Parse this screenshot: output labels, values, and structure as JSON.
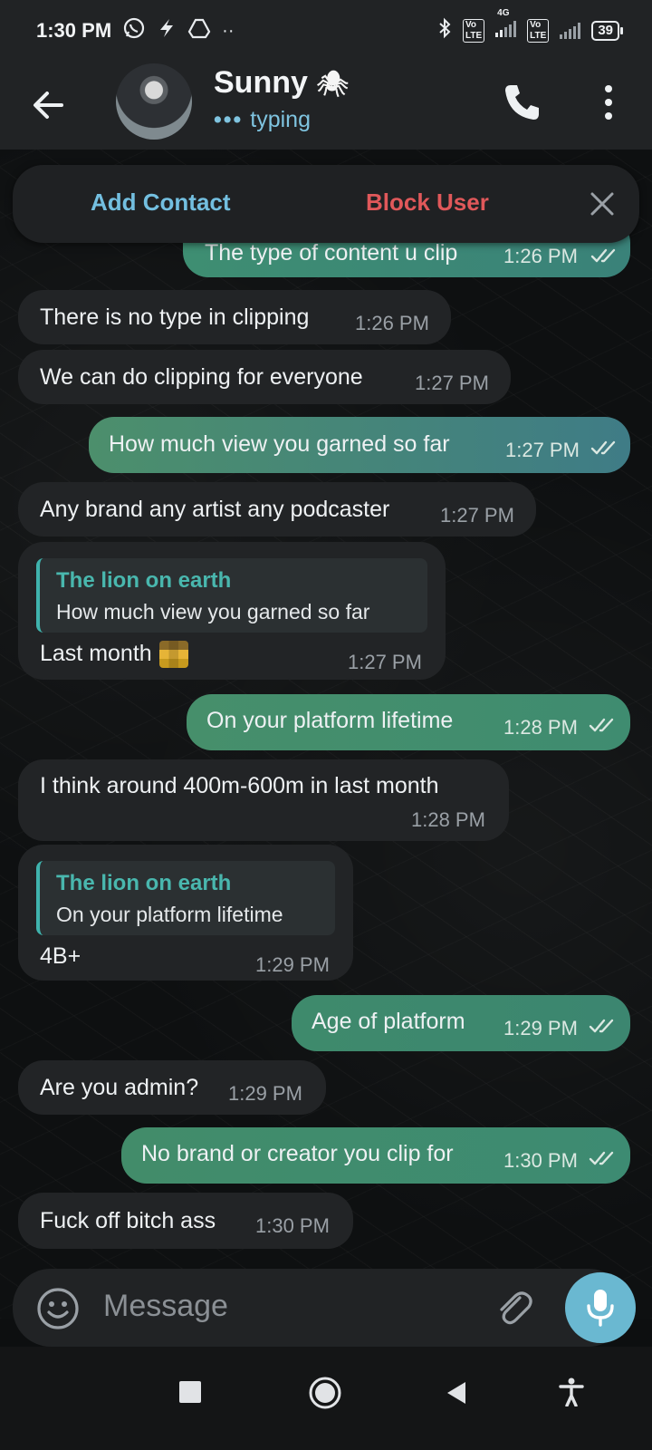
{
  "status_bar": {
    "time": "1:30 PM",
    "battery": "39",
    "network_label": "4G",
    "lte_label": "Vo LTE"
  },
  "header": {
    "contact_name": "Sunny",
    "status": "typing",
    "spider_emoji": "🕷"
  },
  "action_bar": {
    "add_contact": "Add Contact",
    "block_user": "Block User"
  },
  "messages": [
    {
      "dir": "out",
      "text": "The type of content u clip",
      "time": "1:26 PM",
      "read": true
    },
    {
      "dir": "in",
      "text": "There is no type in clipping",
      "time": "1:26 PM"
    },
    {
      "dir": "in",
      "text": "We can do clipping for everyone",
      "time": "1:27 PM"
    },
    {
      "dir": "out",
      "text": "How much view you garned so far",
      "time": "1:27 PM",
      "read": true
    },
    {
      "dir": "in",
      "text": "Any brand any artist any podcaster",
      "time": "1:27 PM"
    },
    {
      "dir": "in",
      "reply_name": "The lion on earth",
      "reply_text": "How much view you garned so far",
      "text": "Last month",
      "time": "1:27 PM"
    },
    {
      "dir": "out",
      "text": "On your platform lifetime",
      "time": "1:28 PM",
      "read": true
    },
    {
      "dir": "in",
      "text": "I think around 400m-600m in last month",
      "time": "1:28 PM"
    },
    {
      "dir": "in",
      "reply_name": "The lion on earth",
      "reply_text": "On your platform lifetime",
      "text": "4B+",
      "time": "1:29 PM"
    },
    {
      "dir": "out",
      "text": "Age of platform",
      "time": "1:29 PM",
      "read": true
    },
    {
      "dir": "in",
      "text": "Are you admin?",
      "time": "1:29 PM"
    },
    {
      "dir": "out",
      "text": "No brand or creator you clip for",
      "time": "1:30 PM",
      "read": true
    },
    {
      "dir": "in",
      "text": "Fuck off bitch ass",
      "time": "1:30 PM"
    }
  ],
  "composer": {
    "placeholder": "Message"
  },
  "icons": {
    "back": "arrow-left",
    "call": "phone",
    "menu": "more-vertical",
    "close": "close-x",
    "emoji": "smiley",
    "attach": "paperclip",
    "mic": "microphone",
    "read_receipt": "double-check"
  },
  "colors": {
    "accent_blue": "#73bfe0",
    "block_red": "#e0585a",
    "reply_teal": "#49b7ae",
    "incoming_bubble": "#222426",
    "outgoing_bubble": "#3f8c70"
  }
}
